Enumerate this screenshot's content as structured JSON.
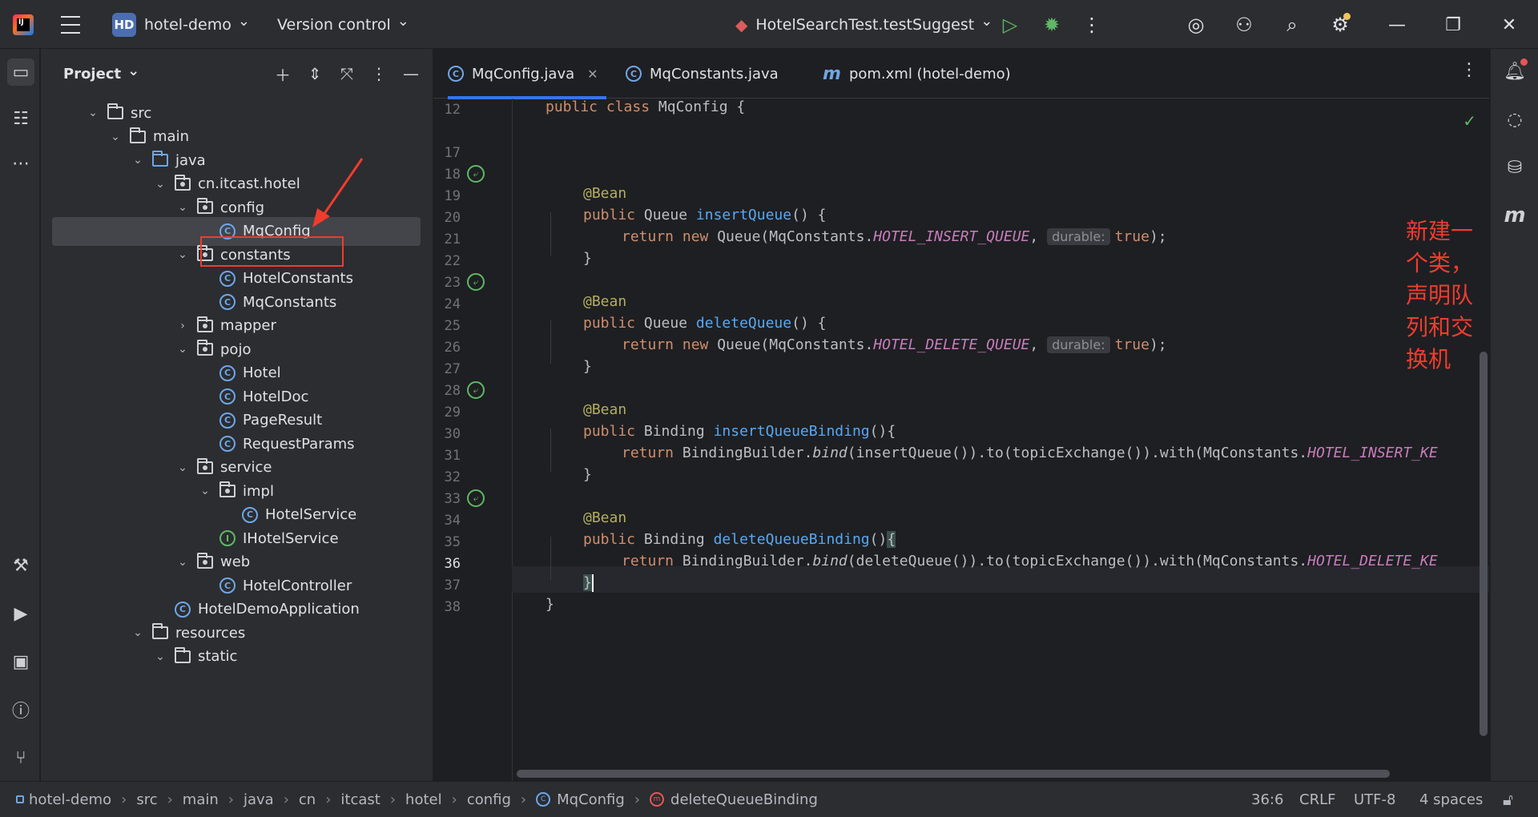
{
  "titlebar": {
    "project_badge": "HD",
    "project_name": "hotel-demo",
    "version_control": "Version control",
    "run_config": "HotelSearchTest.testSuggest"
  },
  "project_panel": {
    "title": "Project",
    "tree": [
      {
        "label": "src",
        "kind": "folder",
        "expanded": true
      },
      {
        "label": "main",
        "kind": "folder",
        "expanded": true
      },
      {
        "label": "java",
        "kind": "folder-blue",
        "expanded": true
      },
      {
        "label": "cn.itcast.hotel",
        "kind": "package",
        "expanded": true
      },
      {
        "label": "config",
        "kind": "package",
        "expanded": true
      },
      {
        "label": "MqConfig",
        "kind": "class",
        "selected": true
      },
      {
        "label": "constants",
        "kind": "package",
        "expanded": true
      },
      {
        "label": "HotelConstants",
        "kind": "class"
      },
      {
        "label": "MqConstants",
        "kind": "class"
      },
      {
        "label": "mapper",
        "kind": "package",
        "expanded": false
      },
      {
        "label": "pojo",
        "kind": "package",
        "expanded": true
      },
      {
        "label": "Hotel",
        "kind": "class"
      },
      {
        "label": "HotelDoc",
        "kind": "class"
      },
      {
        "label": "PageResult",
        "kind": "class"
      },
      {
        "label": "RequestParams",
        "kind": "class"
      },
      {
        "label": "service",
        "kind": "package",
        "expanded": true
      },
      {
        "label": "impl",
        "kind": "package",
        "expanded": true
      },
      {
        "label": "HotelService",
        "kind": "class"
      },
      {
        "label": "IHotelService",
        "kind": "interface"
      },
      {
        "label": "web",
        "kind": "package",
        "expanded": true
      },
      {
        "label": "HotelController",
        "kind": "class"
      },
      {
        "label": "HotelDemoApplication",
        "kind": "app-class"
      },
      {
        "label": "resources",
        "kind": "folder",
        "expanded": true
      },
      {
        "label": "static",
        "kind": "folder",
        "expanded": true
      }
    ]
  },
  "editor": {
    "tabs": [
      {
        "label": "MqConfig.java",
        "active": true
      },
      {
        "label": "MqConstants.java",
        "active": false
      },
      {
        "label": "pom.xml (hotel-demo)",
        "active": false
      }
    ],
    "line_numbers": [
      "12",
      "17",
      "18",
      "19",
      "20",
      "21",
      "22",
      "23",
      "24",
      "25",
      "26",
      "27",
      "28",
      "29",
      "30",
      "31",
      "32",
      "33",
      "34",
      "35",
      "36",
      "37",
      "38"
    ],
    "current_line": "36",
    "annotation_note": "新建一个类，声明队列和交换机",
    "code": {
      "l12_a": "public class ",
      "l12_b": "MqConfig {",
      "bean": "@Bean",
      "public": "public ",
      "queue_type": "Queue ",
      "binding_type": "Binding ",
      "insert_queue": "insertQueue",
      "delete_queue": "deleteQueue",
      "insert_binding": "insertQueueBinding",
      "delete_binding": "deleteQueueBinding",
      "parens_open": "() {",
      "parens_brace": "(){",
      "return_new": "return new ",
      "return": "return ",
      "queue_ctor": "Queue(MqConstants.",
      "insert_const": "HOTEL_INSERT_QUEUE",
      "delete_const": "HOTEL_DELETE_QUEUE",
      "comma": ", ",
      "durable_hint": "durable:",
      "true_end": "true);",
      "close_brace": "}",
      "binding_builder": "BindingBuilder.",
      "bind": "bind",
      "insert_chain": "(insertQueue()).to(topicExchange()).with(MqConstants.",
      "delete_chain": "(deleteQueue()).to(topicExchange()).with(MqConstants.",
      "insert_key": "HOTEL_INSERT_KE",
      "delete_key": "HOTEL_DELETE_KE"
    }
  },
  "statusbar": {
    "breadcrumbs": [
      "hotel-demo",
      "src",
      "main",
      "java",
      "cn",
      "itcast",
      "hotel",
      "config",
      "MqConfig",
      "deleteQueueBinding"
    ],
    "position": "36:6",
    "line_ending": "CRLF",
    "encoding": "UTF-8",
    "indent": "4 spaces"
  },
  "colors": {
    "accent": "#3574f0",
    "annotation_red": "#f03c2e",
    "keyword": "#cf8e6d",
    "method": "#56a8f5",
    "constant": "#c77dbb",
    "annotation": "#b3ae60"
  }
}
